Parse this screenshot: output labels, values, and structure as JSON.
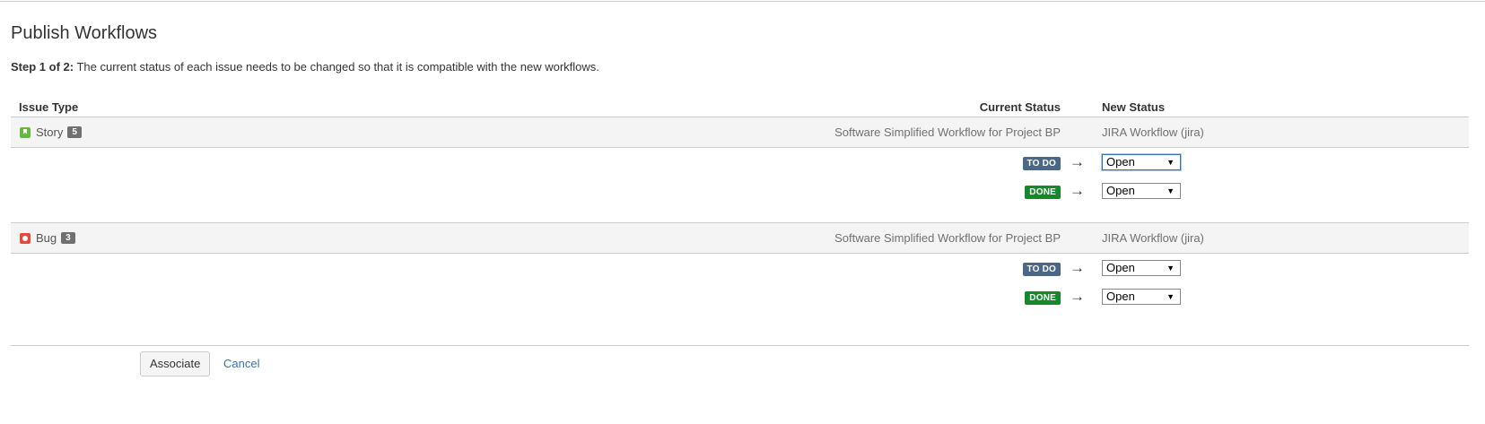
{
  "page": {
    "title": "Publish Workflows",
    "step_label": "Step 1 of 2:",
    "step_text": " The current status of each issue needs to be changed so that it is compatible with the new workflows."
  },
  "table": {
    "headers": {
      "issue_type": "Issue Type",
      "current_status": "Current Status",
      "new_status": "New Status"
    },
    "groups": [
      {
        "issue_type": "Story",
        "icon": "story-icon",
        "icon_color": "#63ba3c",
        "count": "5",
        "current_workflow": "Software Simplified Workflow for Project BP",
        "new_workflow": "JIRA Workflow (jira)",
        "mappings": [
          {
            "from": "TO DO",
            "from_color": "#4a6785",
            "arrow": "→",
            "to": "Open"
          },
          {
            "from": "DONE",
            "from_color": "#14892c",
            "arrow": "→",
            "to": "Open"
          }
        ]
      },
      {
        "issue_type": "Bug",
        "icon": "bug-icon",
        "icon_color": "#e5493a",
        "count": "3",
        "current_workflow": "Software Simplified Workflow for Project BP",
        "new_workflow": "JIRA Workflow (jira)",
        "mappings": [
          {
            "from": "TO DO",
            "from_color": "#4a6785",
            "arrow": "→",
            "to": "Open"
          },
          {
            "from": "DONE",
            "from_color": "#14892c",
            "arrow": "→",
            "to": "Open"
          }
        ]
      }
    ]
  },
  "actions": {
    "associate_label": "Associate",
    "cancel_label": "Cancel"
  },
  "colors": {
    "link": "#3b73af",
    "group_background": "#f4f4f4"
  }
}
